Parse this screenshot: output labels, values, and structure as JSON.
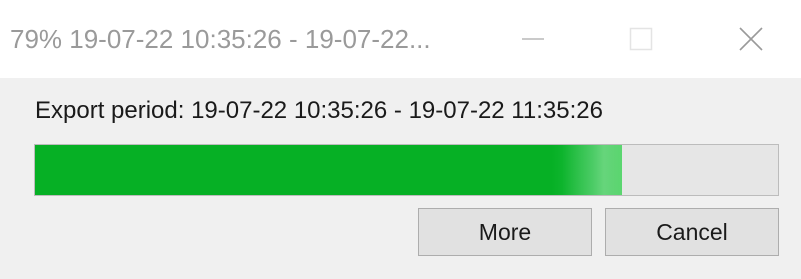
{
  "window": {
    "title": "79% 19-07-22 10:35:26 - 19-07-22..."
  },
  "controls": {
    "minimize_icon": "minimize-icon",
    "maximize_icon": "maximize-icon",
    "close_icon": "close-icon"
  },
  "export": {
    "period_label": "Export period: 19-07-22 10:35:26 - 19-07-22 11:35:26",
    "progress_percent": 79,
    "progress_color": "#06b025"
  },
  "buttons": {
    "more_label": "More",
    "cancel_label": "Cancel"
  }
}
